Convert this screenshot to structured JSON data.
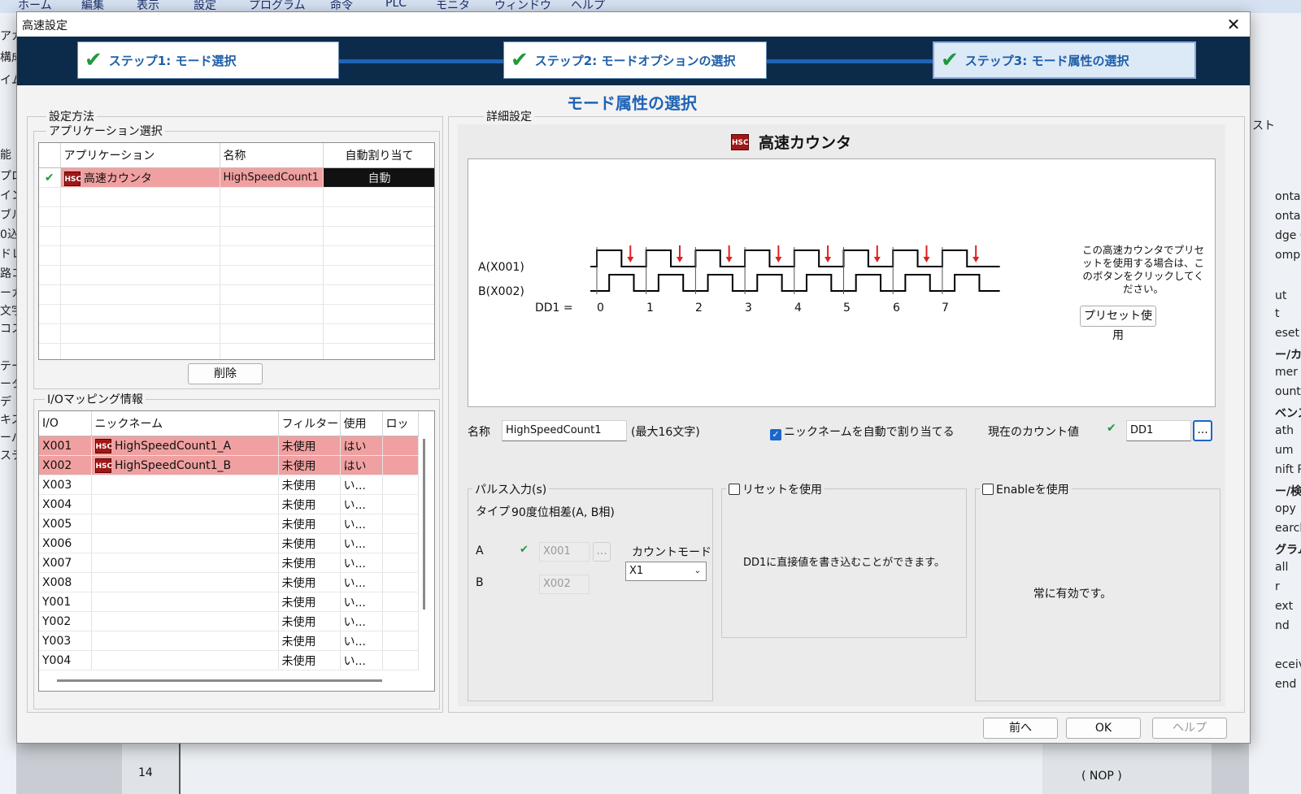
{
  "bg": {
    "menu": [
      "ホーム",
      "編集",
      "表示",
      "設定",
      "プログラム",
      "命令",
      "PLC",
      "モニタ",
      "ウィンドウ",
      "ヘルプ"
    ],
    "left_fragments": [
      "アカ",
      "構成",
      "イム",
      "能",
      "プロ",
      "イン",
      "ブル",
      "0込",
      "ドレ",
      "路コ",
      "ーカ",
      "文字",
      "コス",
      "テー",
      "ータ",
      "デ",
      "キス",
      "ーパ",
      "ステ"
    ],
    "right_fragments": [
      "スト",
      "ontac",
      "ontac",
      "dge C",
      "ompa",
      "ut",
      "t",
      "eset",
      "ー/カウ",
      "mer",
      "ounte",
      "ベンス",
      "ath",
      "um",
      "nift R",
      "ー/検",
      "opy",
      "earch",
      "グラム",
      "all",
      "r",
      "ext",
      "nd",
      "eceive",
      "end"
    ],
    "bottom_cell": "14",
    "bottom_nop": "( NOP )"
  },
  "dialog": {
    "title": "高速設定",
    "heading": "モード属性の選択",
    "steps": [
      {
        "label": "ステップ1: モード選択"
      },
      {
        "label": "ステップ2: モードオプションの選択"
      },
      {
        "label": "ステップ3: モード属性の選択"
      }
    ],
    "colors": {
      "step_bar": "#0c2b4a",
      "connector": "#1f63b5",
      "selected_row": "#f0a0a0",
      "check": "#1d9a3a"
    }
  },
  "left": {
    "method_label": "設定方法",
    "app_group_label": "アプリケーション選択",
    "app_headers": [
      "アプリケーション",
      "名称",
      "自動割り当て"
    ],
    "app_row": {
      "icon": "HSC",
      "app": "高速カウンタ",
      "name": "HighSpeedCount1",
      "auto": "自動"
    },
    "delete_button": "削除",
    "io_group_label": "I/Oマッピング情報",
    "io_headers": [
      "I/O",
      "ニックネーム",
      "フィルター",
      "使用",
      "ロッ"
    ],
    "io_rows": [
      {
        "io": "X001",
        "icon": "HSC",
        "nick": "HighSpeedCount1_A",
        "filter": "未使用",
        "use": "はい"
      },
      {
        "io": "X002",
        "icon": "HSC",
        "nick": "HighSpeedCount1_B",
        "filter": "未使用",
        "use": "はい"
      },
      {
        "io": "X003",
        "icon": "",
        "nick": "",
        "filter": "未使用",
        "use": "い..."
      },
      {
        "io": "X004",
        "icon": "",
        "nick": "",
        "filter": "未使用",
        "use": "い..."
      },
      {
        "io": "X005",
        "icon": "",
        "nick": "",
        "filter": "未使用",
        "use": "い..."
      },
      {
        "io": "X006",
        "icon": "",
        "nick": "",
        "filter": "未使用",
        "use": "い..."
      },
      {
        "io": "X007",
        "icon": "",
        "nick": "",
        "filter": "未使用",
        "use": "い..."
      },
      {
        "io": "X008",
        "icon": "",
        "nick": "",
        "filter": "未使用",
        "use": "い..."
      },
      {
        "io": "Y001",
        "icon": "",
        "nick": "",
        "filter": "未使用",
        "use": "い..."
      },
      {
        "io": "Y002",
        "icon": "",
        "nick": "",
        "filter": "未使用",
        "use": "い..."
      },
      {
        "io": "Y003",
        "icon": "",
        "nick": "",
        "filter": "未使用",
        "use": "い..."
      },
      {
        "io": "Y004",
        "icon": "",
        "nick": "",
        "filter": "未使用",
        "use": "い..."
      }
    ]
  },
  "right": {
    "detail_label": "詳細設定",
    "counter_icon": "HSC",
    "counter_title": "高速カウンタ",
    "diagram": {
      "signal_a": "A(X001)",
      "signal_b": "B(X002)",
      "dd_label": "DD1 =",
      "counts": [
        "0",
        "1",
        "2",
        "3",
        "4",
        "5",
        "6",
        "7"
      ],
      "pulse_color": "#000000",
      "arrow_color": "#e02020"
    },
    "preset_hint": "この高速カウンタでプリセットを使用する場合は、このボタンをクリックしてください。",
    "preset_button": "プリセット使用",
    "name_label": "名称",
    "name_value": "HighSpeedCount1",
    "max_chars": "(最大16文字)",
    "auto_nick_checkbox": "ニックネームを自動で割り当てる",
    "auto_nick_checked": true,
    "current_count_label": "現在のカウント値",
    "current_count_value": "DD1",
    "browse_button": "...",
    "pulse_group_label": "パルス入力(s)",
    "type_label": "タイプ",
    "type_value": "90度位相差(A, B相)",
    "a_label": "A",
    "a_value": "X001",
    "a_browse": "...",
    "b_label": "B",
    "b_value": "X002",
    "count_mode_label": "カウントモード",
    "count_mode_value": "X1",
    "reset_checkbox": "リセットを使用",
    "reset_checked": false,
    "reset_desc": "DD1に直接値を書き込むことができます。",
    "enable_checkbox": "Enableを使用",
    "enable_checked": false,
    "enable_desc": "常に有効です。"
  },
  "footer": {
    "prev": "前へ",
    "ok": "OK",
    "help": "ヘルプ"
  }
}
